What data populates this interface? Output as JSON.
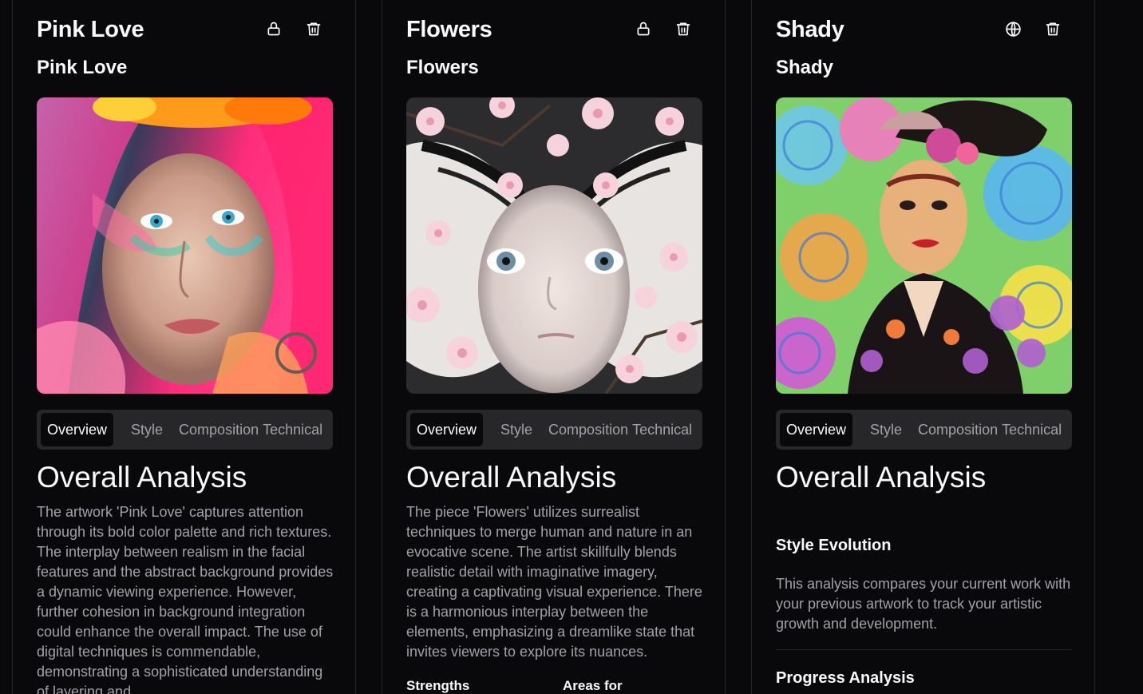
{
  "cards": [
    {
      "title": "Pink Love",
      "subtitle": "Pink Love",
      "icons": [
        "lock-icon",
        "trash-icon"
      ],
      "tabs": [
        "Overview",
        "Style",
        "Composition",
        "Technical"
      ],
      "heading": "Overall Analysis",
      "body": "The artwork 'Pink Love' captures attention through its bold color palette and rich textures. The interplay between realism in the facial features and the abstract background provides a dynamic viewing experience. However, further cohesion in background integration could enhance the overall impact. The use of digital techniques is commendable, demonstrating a sophisticated understanding of layering and",
      "image_alt": "Portrait of a woman with pink hair and colorful face paint"
    },
    {
      "title": "Flowers",
      "subtitle": "Flowers",
      "icons": [
        "lock-icon",
        "trash-icon"
      ],
      "tabs": [
        "Overview",
        "Style",
        "Composition",
        "Technical"
      ],
      "heading": "Overall Analysis",
      "body": "The piece 'Flowers' utilizes surrealist techniques to merge human and nature in an evocative scene. The artist skillfully blends realistic detail with imaginative imagery, creating a captivating visual experience. There is a harmonious interplay between the elements, emphasizing a dreamlike state that invites viewers to explore its nuances.",
      "strengths": "Strengths",
      "areas": "Areas for",
      "image_alt": "Surreal face framed by butterfly wings and cherry blossoms"
    },
    {
      "title": "Shady",
      "subtitle": "Shady",
      "icons": [
        "globe-icon",
        "trash-icon"
      ],
      "tabs": [
        "Overview",
        "Style",
        "Composition",
        "Technical"
      ],
      "heading": "Overall Analysis",
      "style_evolution": "Style Evolution",
      "style_evolution_text": "This analysis compares your current work with your previous artwork to track your artistic growth and development.",
      "progress": "Progress Analysis",
      "image_alt": "Psychedelic portrait of a woman in a hat with swirling colors"
    }
  ],
  "colors": {
    "background": "#09090b",
    "border": "#27272a",
    "muted_text": "#a1a1aa",
    "tab_bg": "#27272a"
  }
}
